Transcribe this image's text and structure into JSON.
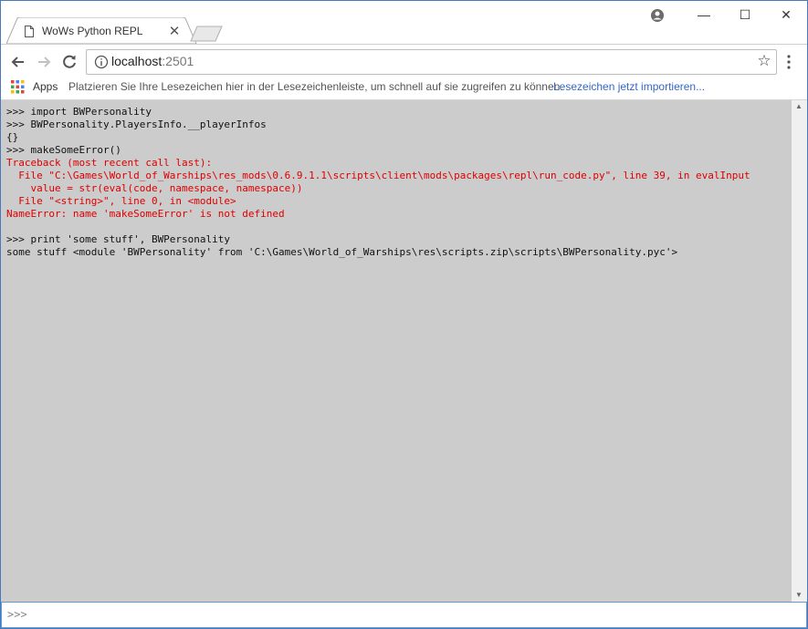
{
  "browser": {
    "tab_title": "WoWs Python REPL",
    "tab_close": "✕",
    "url_host": "localhost",
    "url_port": ":2501",
    "controls": {
      "minimize": "—",
      "maximize": "☐",
      "close": "✕"
    }
  },
  "bookmarks": {
    "apps_label": "Apps",
    "hint": "Platzieren Sie Ihre Lesezeichen hier in der Lesezeichenleiste, um schnell auf sie zugreifen zu können.",
    "import_link": "Lesezeichen jetzt importieren..."
  },
  "console": {
    "lines": [
      {
        "text": ">>> import BWPersonality",
        "type": "normal"
      },
      {
        "text": ">>> BWPersonality.PlayersInfo.__playerInfos",
        "type": "normal"
      },
      {
        "text": "{}",
        "type": "normal"
      },
      {
        "text": ">>> makeSomeError()",
        "type": "normal"
      },
      {
        "text": "Traceback (most recent call last):",
        "type": "error"
      },
      {
        "text": "  File \"C:\\Games\\World_of_Warships\\res_mods\\0.6.9.1.1\\scripts\\client\\mods\\packages\\repl\\run_code.py\", line 39, in evalInput",
        "type": "error"
      },
      {
        "text": "    value = str(eval(code, namespace, namespace))",
        "type": "error"
      },
      {
        "text": "  File \"<string>\", line 0, in <module>",
        "type": "error"
      },
      {
        "text": "NameError: name 'makeSomeError' is not defined",
        "type": "error"
      },
      {
        "text": "",
        "type": "normal"
      },
      {
        "text": ">>> print 'some stuff', BWPersonality",
        "type": "normal"
      },
      {
        "text": "some stuff <module 'BWPersonality' from 'C:\\Games\\World_of_Warships\\res\\scripts.zip\\scripts\\BWPersonality.pyc'>",
        "type": "normal"
      }
    ]
  },
  "input": {
    "placeholder": ">>>",
    "value": ""
  },
  "colors": {
    "console_bg": "#cccccc",
    "error_text": "#dd0000",
    "link": "#3366cc"
  }
}
